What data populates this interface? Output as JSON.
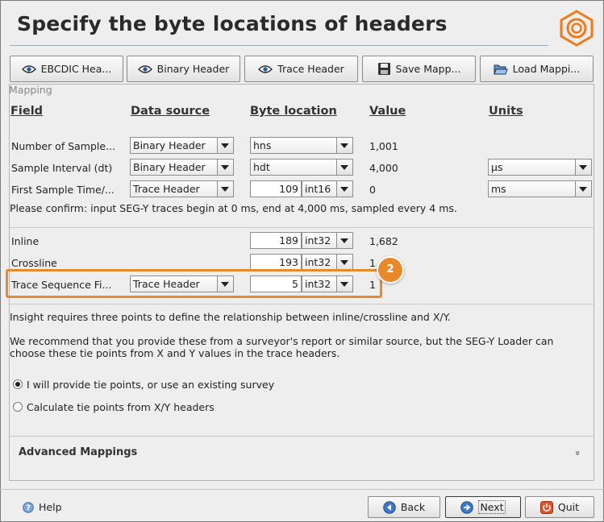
{
  "header": {
    "title": "Specify the byte locations of headers"
  },
  "toolbar": {
    "ebcdic": "EBCDIC Hea...",
    "binary": "Binary Header",
    "trace": "Trace Header",
    "save": "Save Mapp...",
    "load": "Load Mappi..."
  },
  "mapping": {
    "section_label": "Mapping",
    "headers": {
      "field": "Field",
      "source": "Data source",
      "byte": "Byte location",
      "value": "Value",
      "units": "Units"
    },
    "rows": [
      {
        "field": "Number of Sample...",
        "source": "Binary Header",
        "byte": "hns",
        "value": "1,001",
        "units": ""
      },
      {
        "field": "Sample Interval (dt)",
        "source": "Binary Header",
        "byte": "hdt",
        "value": "4,000",
        "units": "µs"
      },
      {
        "field": "First Sample Time/...",
        "source": "Trace Header",
        "byte": "109",
        "type": "int16",
        "value": "0",
        "units": "ms"
      }
    ],
    "confirm": "Please confirm: input SEG-Y traces begin at 0 ms, end at 4,000 ms, sampled every 4 ms.",
    "rows2": [
      {
        "field": "Inline",
        "byte": "189",
        "type": "int32",
        "value": "1,682"
      },
      {
        "field": "Crossline",
        "byte": "193",
        "type": "int32",
        "value": "1"
      },
      {
        "field": "Trace Sequence Fi...",
        "source": "Trace Header",
        "byte": "5",
        "type": "int32",
        "value": "1"
      }
    ],
    "badge": "2"
  },
  "tiepoints": {
    "para1": "Insight requires three points to define the relationship between inline/crossline and X/Y.",
    "para2": "We recommend that you provide these from a surveyor's report or similar source, but the SEG-Y Loader can choose these tie points from X and Y values in the trace headers.",
    "option1": "I will provide tie points, or use an existing survey",
    "option2": "Calculate tie points from X/Y headers",
    "selected": "option1"
  },
  "advanced": {
    "label": "Advanced Mappings",
    "chevron": "»"
  },
  "footer": {
    "help": "Help",
    "back": "Back",
    "next": "Next",
    "quit": "Quit"
  },
  "colors": {
    "accent": "#e8892a",
    "logo": "#f07a1a"
  }
}
